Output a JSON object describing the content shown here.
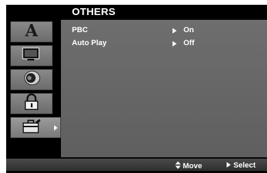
{
  "menu": {
    "title": "OTHERS"
  },
  "sidebar": {
    "tabs": [
      {
        "icon": "font-letter-icon"
      },
      {
        "icon": "tv-screen-icon"
      },
      {
        "icon": "speaker-icon"
      },
      {
        "icon": "padlock-icon"
      },
      {
        "icon": "others-toolbox-icon",
        "active": true
      }
    ]
  },
  "settings": [
    {
      "label": "PBC",
      "value": "On"
    },
    {
      "label": "Auto Play",
      "value": "Off"
    }
  ],
  "footer": {
    "move_label": "Move",
    "select_label": "Select"
  },
  "colors": {
    "panel": "#6e6e6e",
    "tab": "#7a7a7a",
    "background": "#000000",
    "text": "#ffffff"
  }
}
